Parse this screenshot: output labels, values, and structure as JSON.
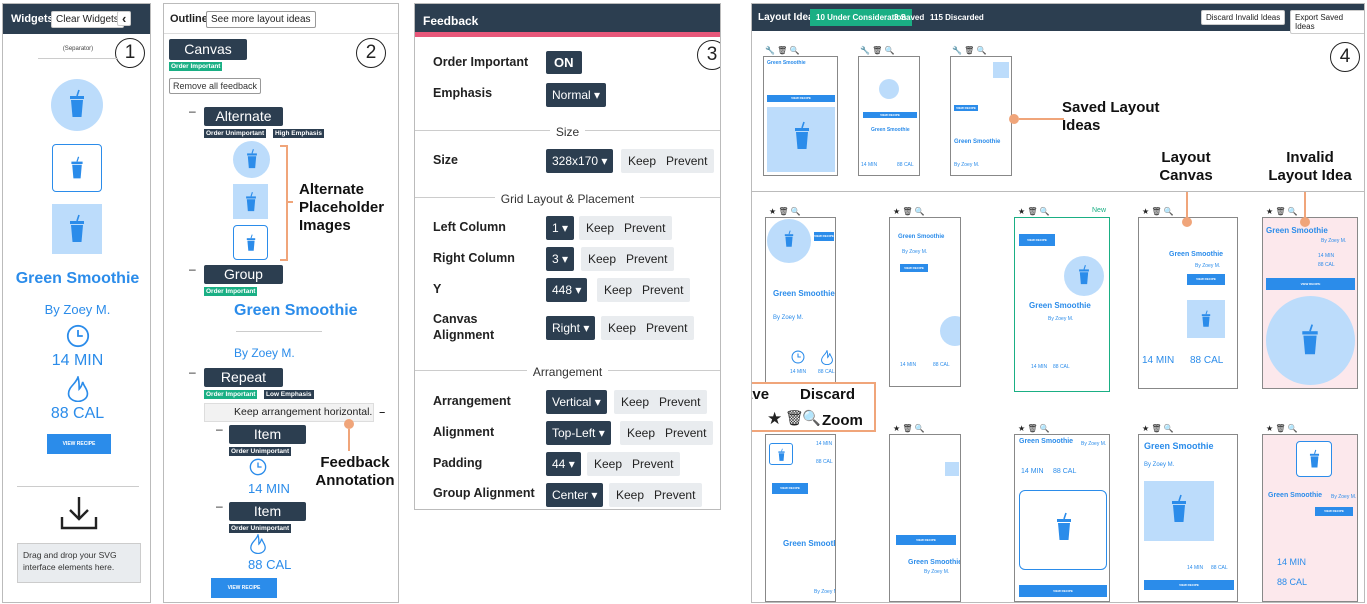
{
  "widgets": {
    "title": "Widgets",
    "clear": "Clear Widgets",
    "collapse": "‹",
    "separator": "(Separator)",
    "heading": "Green Smoothie",
    "author": "By Zoey M.",
    "time": "14 MIN",
    "cal": "88 CAL",
    "button": "VIEW RECIPE",
    "drop": "Drag and drop your SVG interface elements here.",
    "num": "1"
  },
  "outline": {
    "title": "Outline",
    "more": "See more layout ideas",
    "canvas": "Canvas",
    "canvas_tag": "Order Important",
    "remove": "Remove all feedback",
    "alt": "Alternate",
    "alt_tags": [
      "Order Unimportant",
      "High Emphasis"
    ],
    "group": "Group",
    "group_tag": "Order Important",
    "heading": "Green Smoothie",
    "author": "By Zoey M.",
    "repeat": "Repeat",
    "repeat_tags": [
      "Order Important",
      "Low Emphasis"
    ],
    "fb_note": "Keep arrangement horizontal.",
    "item": "Item",
    "item_tag": "Order Unimportant",
    "time": "14 MIN",
    "cal": "88 CAL",
    "button": "VIEW RECIPE",
    "num": "2",
    "dash": "–"
  },
  "feedback": {
    "title": "Feedback",
    "num": "3",
    "keep": "Keep",
    "prevent": "Prevent",
    "order_label": "Order Important",
    "order_val": "ON",
    "emph_label": "Emphasis",
    "emph_val": "Normal",
    "size_sect": "Size",
    "size_label": "Size",
    "size_val": "328x170",
    "grid_sect": "Grid Layout & Placement",
    "left_label": "Left Column",
    "left_val": "1",
    "right_label": "Right Column",
    "right_val": "3",
    "y_label": "Y",
    "y_val": "448",
    "align_label": "Canvas Alignment",
    "align_val": "Right",
    "arr_sect": "Arrangement",
    "arrangement_label": "Arrangement",
    "arrangement_val": "Vertical",
    "alignment_label": "Alignment",
    "alignment_val": "Top-Left",
    "padding_label": "Padding",
    "padding_val": "44",
    "galign_label": "Group Alignment",
    "galign_val": "Center"
  },
  "ideas": {
    "title": "Layout Ideas",
    "under": "10 Under Consideration",
    "saved": "3 Saved",
    "discarded": "115 Discarded",
    "discard_btn": "Discard Invalid Ideas",
    "export_btn": "Export Saved Ideas",
    "num": "4",
    "heading": "Green Smoothie",
    "author": "By Zoey M.",
    "time": "14 MIN",
    "cal": "88 CAL",
    "button": "VIEW RECIPE",
    "new": "New"
  },
  "annotations": {
    "alt_ph": "Alternate Placeholder Images",
    "fb_ann": "Feedback Annotation",
    "saved": "Saved Layout Ideas",
    "canvas": "Layout Canvas",
    "invalid": "Invalid Layout Idea",
    "save": "Save",
    "discard": "Discard",
    "zoom": "Zoom"
  },
  "icons": {
    "cup": "smoothie-cup-icon",
    "clock": "clock-icon",
    "flame": "flame-icon",
    "download": "download-icon",
    "star": "star-icon",
    "trash": "trash-icon",
    "zoom": "zoom-icon",
    "wrench": "wrench-icon"
  },
  "colors": {
    "accent": "#2b8cea",
    "dark": "#2c3e50",
    "green": "#1aaf84",
    "pink": "#e8577a",
    "orange": "#f0a57a"
  }
}
